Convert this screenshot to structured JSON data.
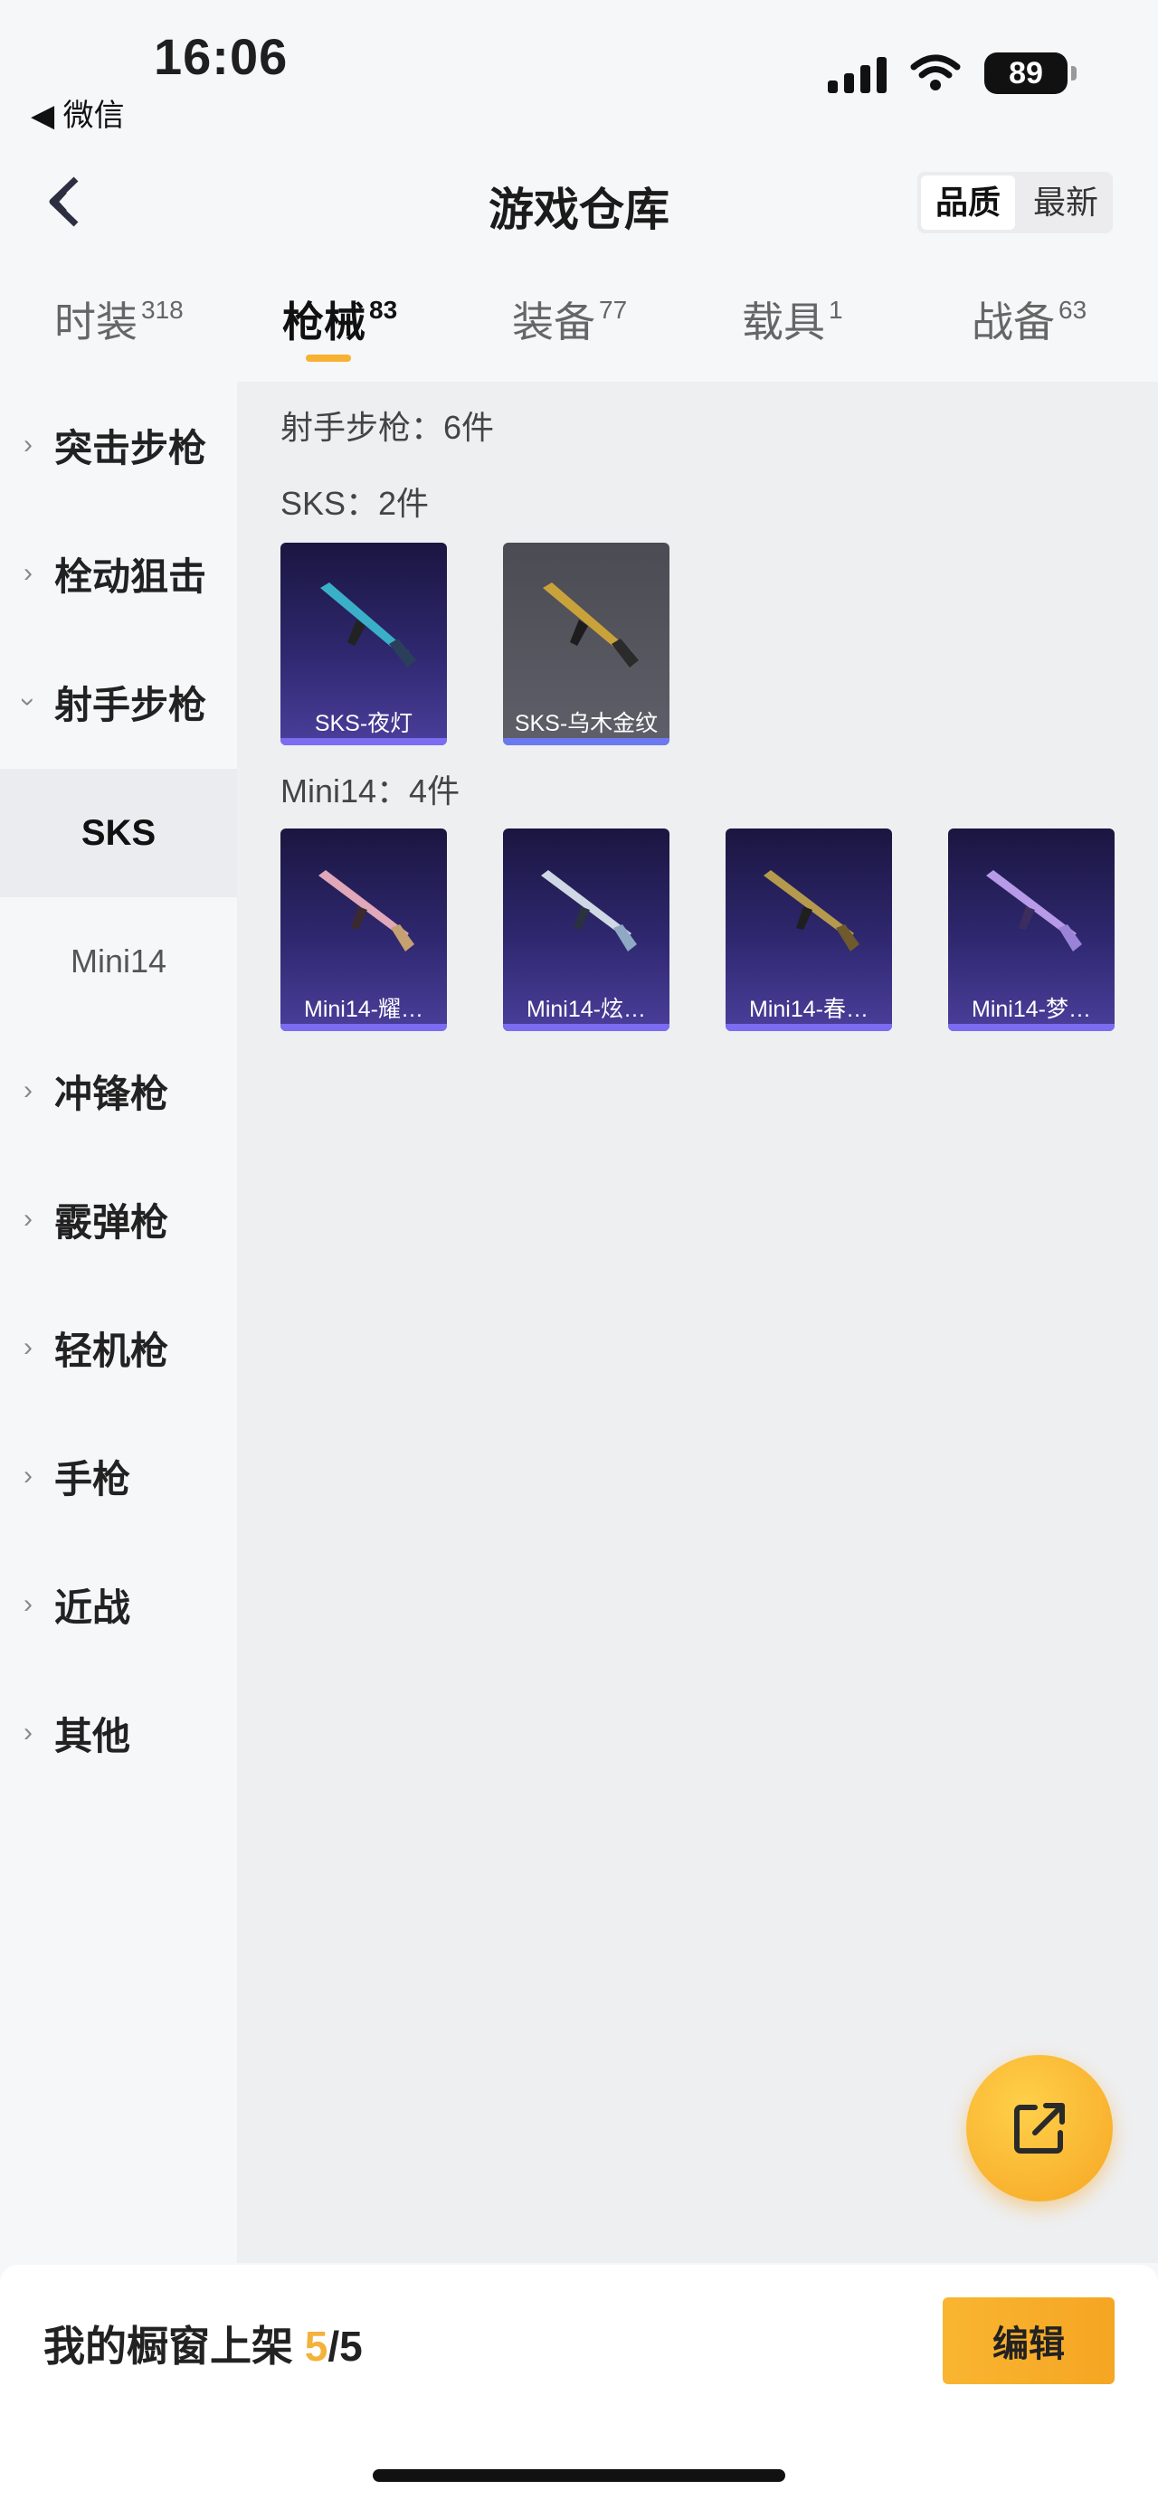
{
  "status_bar": {
    "time": "16:06",
    "back_label": "◀ 微信",
    "battery": "89"
  },
  "header": {
    "title": "游戏仓库",
    "sort": [
      "品质",
      "最新"
    ]
  },
  "tabs": [
    {
      "label": "时装",
      "count": "318"
    },
    {
      "label": "枪械",
      "count": "83"
    },
    {
      "label": "装备",
      "count": "77"
    },
    {
      "label": "载具",
      "count": "1"
    },
    {
      "label": "战备",
      "count": "63"
    }
  ],
  "sidebar": {
    "items": [
      "突击步枪",
      "栓动狙击",
      "射手步枪",
      "冲锋枪",
      "霰弹枪",
      "轻机枪",
      "手枪",
      "近战",
      "其他"
    ],
    "sub_items": [
      "SKS",
      "Mini14"
    ]
  },
  "content": {
    "section_title": "射手步枪：6件",
    "groups": [
      {
        "title": "SKS：2件",
        "items": [
          "SKS-夜灯",
          "SKS-乌木金纹"
        ]
      },
      {
        "title": "Mini14：4件",
        "items": [
          "Mini14-耀…",
          "Mini14-炫…",
          "Mini14-春…",
          "Mini14-梦…"
        ]
      }
    ]
  },
  "bottom": {
    "shelf_label": "我的橱窗上架",
    "shelf_current": "5",
    "shelf_total": "/5",
    "edit_label": "编辑"
  }
}
